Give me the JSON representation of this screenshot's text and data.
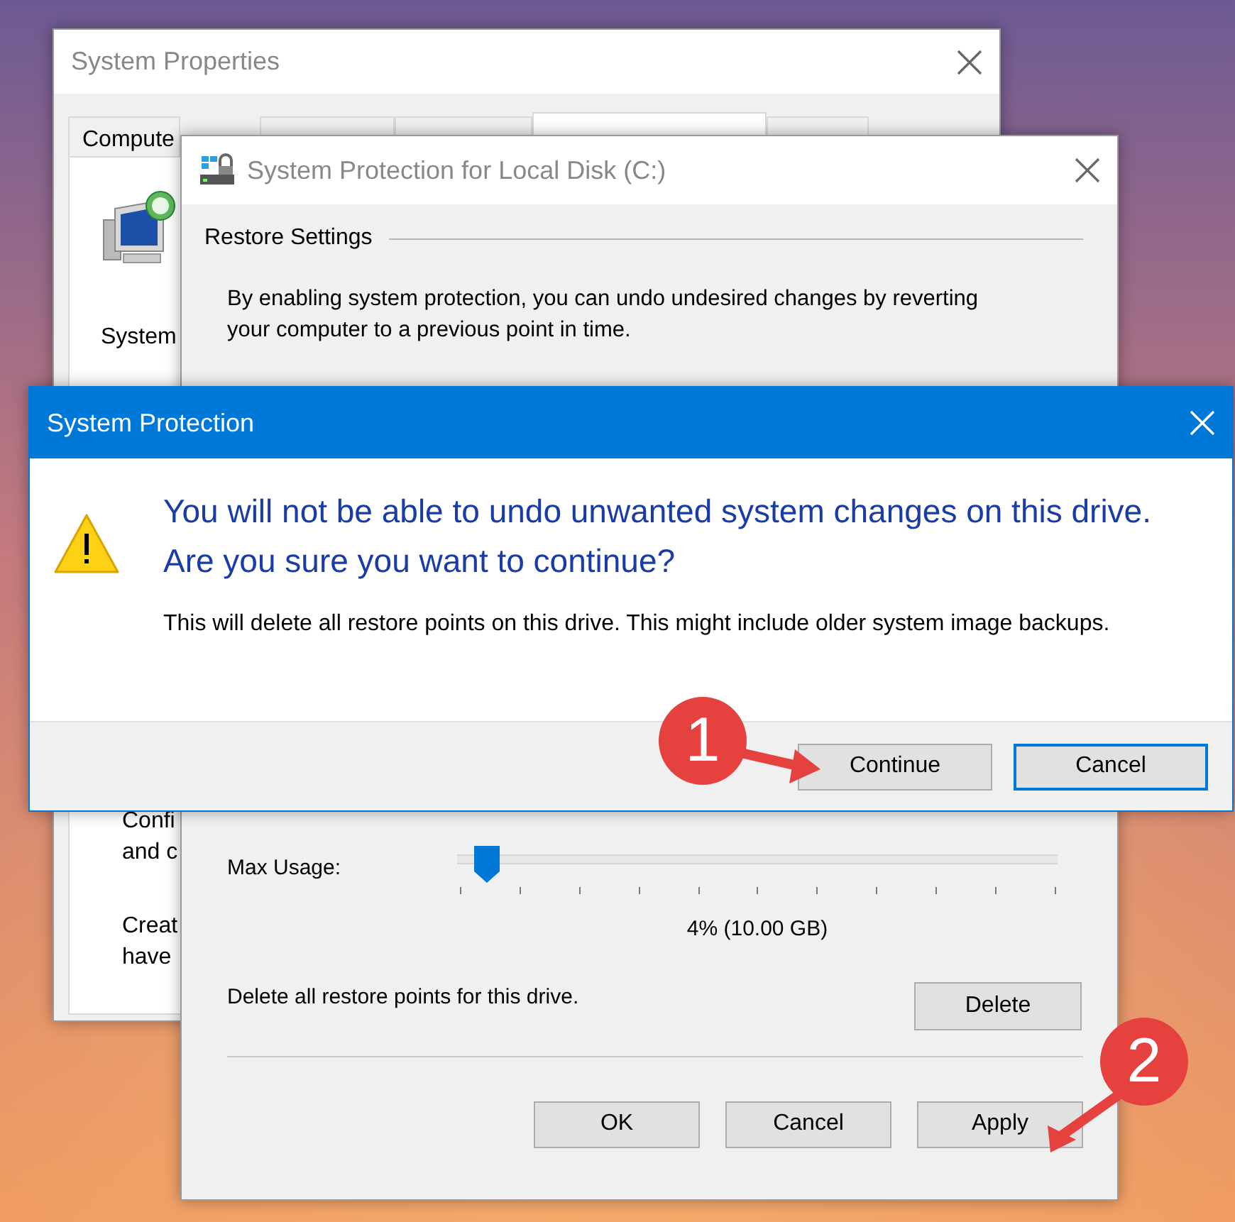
{
  "system_properties": {
    "title": "System Properties",
    "tabs": [
      {
        "label": "Compute",
        "selected": false
      },
      {
        "selected": false
      },
      {
        "selected": false
      },
      {
        "selected": true
      },
      {
        "selected": false
      }
    ],
    "texts": [
      "System",
      "Confi",
      "and c",
      "Creat",
      "have"
    ]
  },
  "protection_window": {
    "title": "System Protection for Local Disk (C:)",
    "group_title": "Restore Settings",
    "description": "By enabling system protection, you can undo undesired changes by reverting your computer to a previous point in time.",
    "max_usage": {
      "label": "Max Usage:",
      "level": 0.05,
      "reading": "4% (10.00 GB)"
    },
    "delete": {
      "text": "Delete all restore points for this drive.",
      "button": "Delete"
    },
    "buttons": [
      {
        "label": "OK"
      },
      {
        "label": "Cancel"
      },
      {
        "label": "Apply"
      }
    ]
  },
  "confirm_dialog": {
    "title": "System Protection",
    "instruction": "You will not be able to undo unwanted system changes on this drive. Are you sure you want to continue?",
    "body": "This will delete all restore points on this drive. This might include older system image backups.",
    "buttons": [
      {
        "label": "Continue",
        "default": false
      },
      {
        "label": "Cancel",
        "default": true
      }
    ]
  },
  "annotations": [
    {
      "number": "1"
    },
    {
      "number": "2"
    }
  ]
}
